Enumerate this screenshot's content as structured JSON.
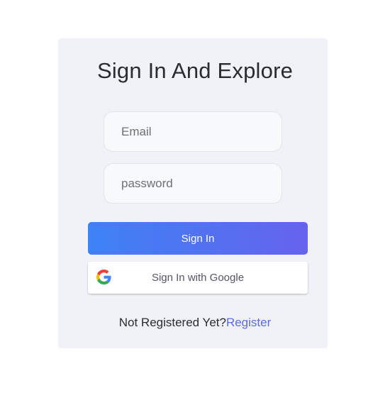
{
  "form": {
    "title": "Sign In And Explore",
    "email_placeholder": "Email",
    "password_placeholder": "password",
    "sign_in_label": "Sign In",
    "google_label": "Sign In with Google",
    "footer_text": "Not Registered Yet?",
    "register_link": "Register"
  },
  "colors": {
    "card_background": "#f1f2f7",
    "button_gradient_start": "#3d82f6",
    "button_gradient_end": "#6663ee",
    "link": "#5b6ce6"
  },
  "icons": {
    "google": "google-logo-icon"
  }
}
